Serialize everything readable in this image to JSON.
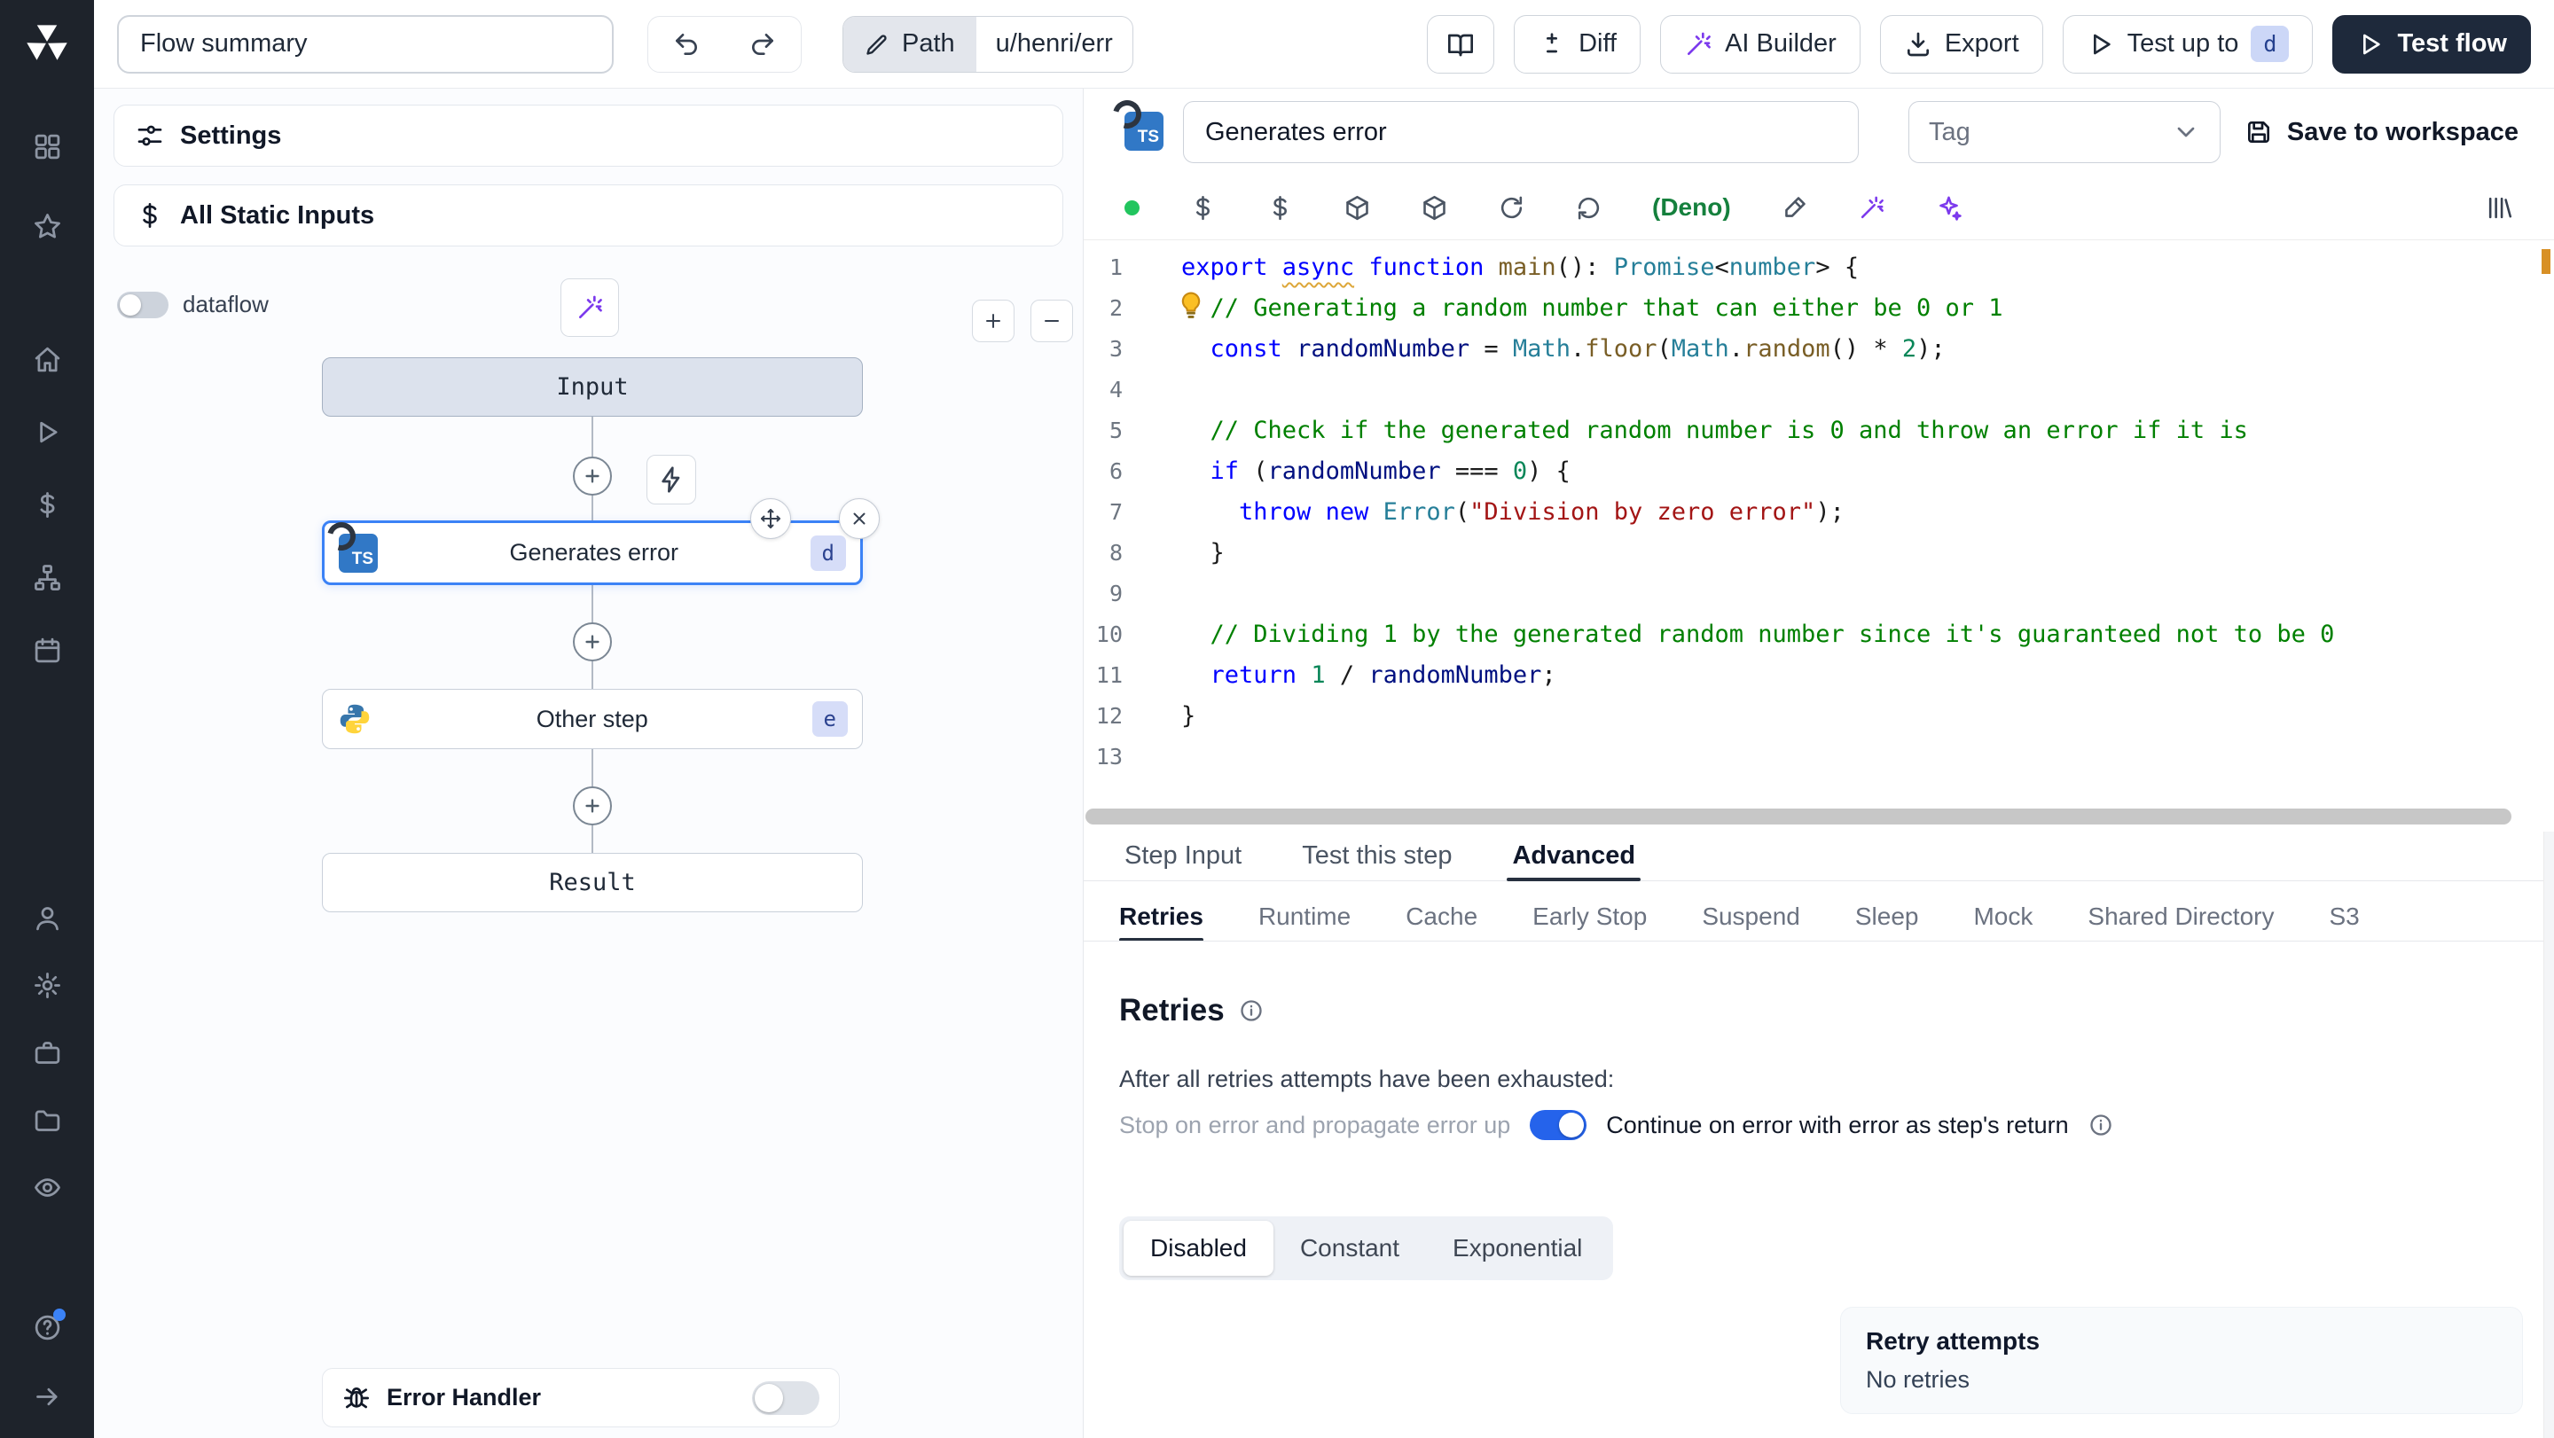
{
  "topbar": {
    "flow_summary": "Flow summary",
    "path_label": "Path",
    "path_value": "u/henri/err",
    "diff": "Diff",
    "ai_builder": "AI Builder",
    "export": "Export",
    "test_up_to": "Test up to",
    "test_up_to_badge": "d",
    "test_flow": "Test flow"
  },
  "flow": {
    "settings": "Settings",
    "all_static_inputs": "All Static Inputs",
    "dataflow": "dataflow",
    "input_node": "Input",
    "step1": {
      "label": "Generates error",
      "badge": "d",
      "lang": "TS"
    },
    "step2": {
      "label": "Other step",
      "badge": "e"
    },
    "result_node": "Result",
    "error_handler": "Error Handler"
  },
  "editor": {
    "lang_badge": "TS",
    "step_name": "Generates error",
    "tag": "Tag",
    "save": "Save to workspace",
    "runtime": "(Deno)",
    "code": {
      "lines": [
        [
          [
            "k",
            "export "
          ],
          [
            "kw",
            "async"
          ],
          [
            "k",
            " function "
          ],
          [
            "fn",
            "main"
          ],
          [
            "d",
            "(): "
          ],
          [
            "ty",
            "Promise"
          ],
          [
            "d",
            "<"
          ],
          [
            "ty",
            "number"
          ],
          [
            "d",
            "> {"
          ]
        ],
        [
          [
            "d",
            "  "
          ],
          [
            "c",
            "// Generating a random number that can either be 0 or 1"
          ]
        ],
        [
          [
            "d",
            "  "
          ],
          [
            "k",
            "const "
          ],
          [
            "v",
            "randomNumber"
          ],
          [
            "d",
            " = "
          ],
          [
            "ty",
            "Math"
          ],
          [
            "d",
            "."
          ],
          [
            "fn",
            "floor"
          ],
          [
            "d",
            "("
          ],
          [
            "ty",
            "Math"
          ],
          [
            "d",
            "."
          ],
          [
            "fn",
            "random"
          ],
          [
            "d",
            "() * "
          ],
          [
            "n",
            "2"
          ],
          [
            "d",
            ");"
          ]
        ],
        [],
        [
          [
            "d",
            "  "
          ],
          [
            "c",
            "// Check if the generated random number is 0 and throw an error if it is"
          ]
        ],
        [
          [
            "d",
            "  "
          ],
          [
            "k",
            "if"
          ],
          [
            "d",
            " ("
          ],
          [
            "v",
            "randomNumber"
          ],
          [
            "d",
            " === "
          ],
          [
            "n",
            "0"
          ],
          [
            "d",
            ") {"
          ]
        ],
        [
          [
            "d",
            "    "
          ],
          [
            "k",
            "throw"
          ],
          [
            "d",
            " "
          ],
          [
            "k",
            "new"
          ],
          [
            "d",
            " "
          ],
          [
            "ty",
            "Error"
          ],
          [
            "d",
            "("
          ],
          [
            "s",
            "\"Division by zero error\""
          ],
          [
            "d",
            ");"
          ]
        ],
        [
          [
            "d",
            "  }"
          ]
        ],
        [],
        [
          [
            "d",
            "  "
          ],
          [
            "c",
            "// Dividing 1 by the generated random number since it's guaranteed not to be 0"
          ]
        ],
        [
          [
            "d",
            "  "
          ],
          [
            "k",
            "return "
          ],
          [
            "n",
            "1"
          ],
          [
            "d",
            " / "
          ],
          [
            "v",
            "randomNumber"
          ],
          [
            "d",
            ";"
          ]
        ],
        [
          [
            "d",
            "}"
          ]
        ],
        []
      ]
    }
  },
  "tabs": {
    "items": [
      {
        "label": "Step Input"
      },
      {
        "label": "Test this step"
      },
      {
        "label": "Advanced"
      }
    ],
    "active": "Advanced"
  },
  "advanced": {
    "subtabs": [
      {
        "label": "Retries"
      },
      {
        "label": "Runtime"
      },
      {
        "label": "Cache"
      },
      {
        "label": "Early Stop"
      },
      {
        "label": "Suspend"
      },
      {
        "label": "Sleep"
      },
      {
        "label": "Mock"
      },
      {
        "label": "Shared Directory"
      },
      {
        "label": "S3"
      }
    ],
    "active": "Retries"
  },
  "retries": {
    "title": "Retries",
    "exhausted_text": "After all retries attempts have been exhausted:",
    "stop_label": "Stop on error and propagate error up",
    "continue_label": "Continue on error with error as step's return",
    "modes": [
      {
        "label": "Disabled"
      },
      {
        "label": "Constant"
      },
      {
        "label": "Exponential"
      }
    ],
    "active_mode": "Disabled",
    "summary": {
      "title": "Retry attempts",
      "value": "No retries"
    }
  }
}
